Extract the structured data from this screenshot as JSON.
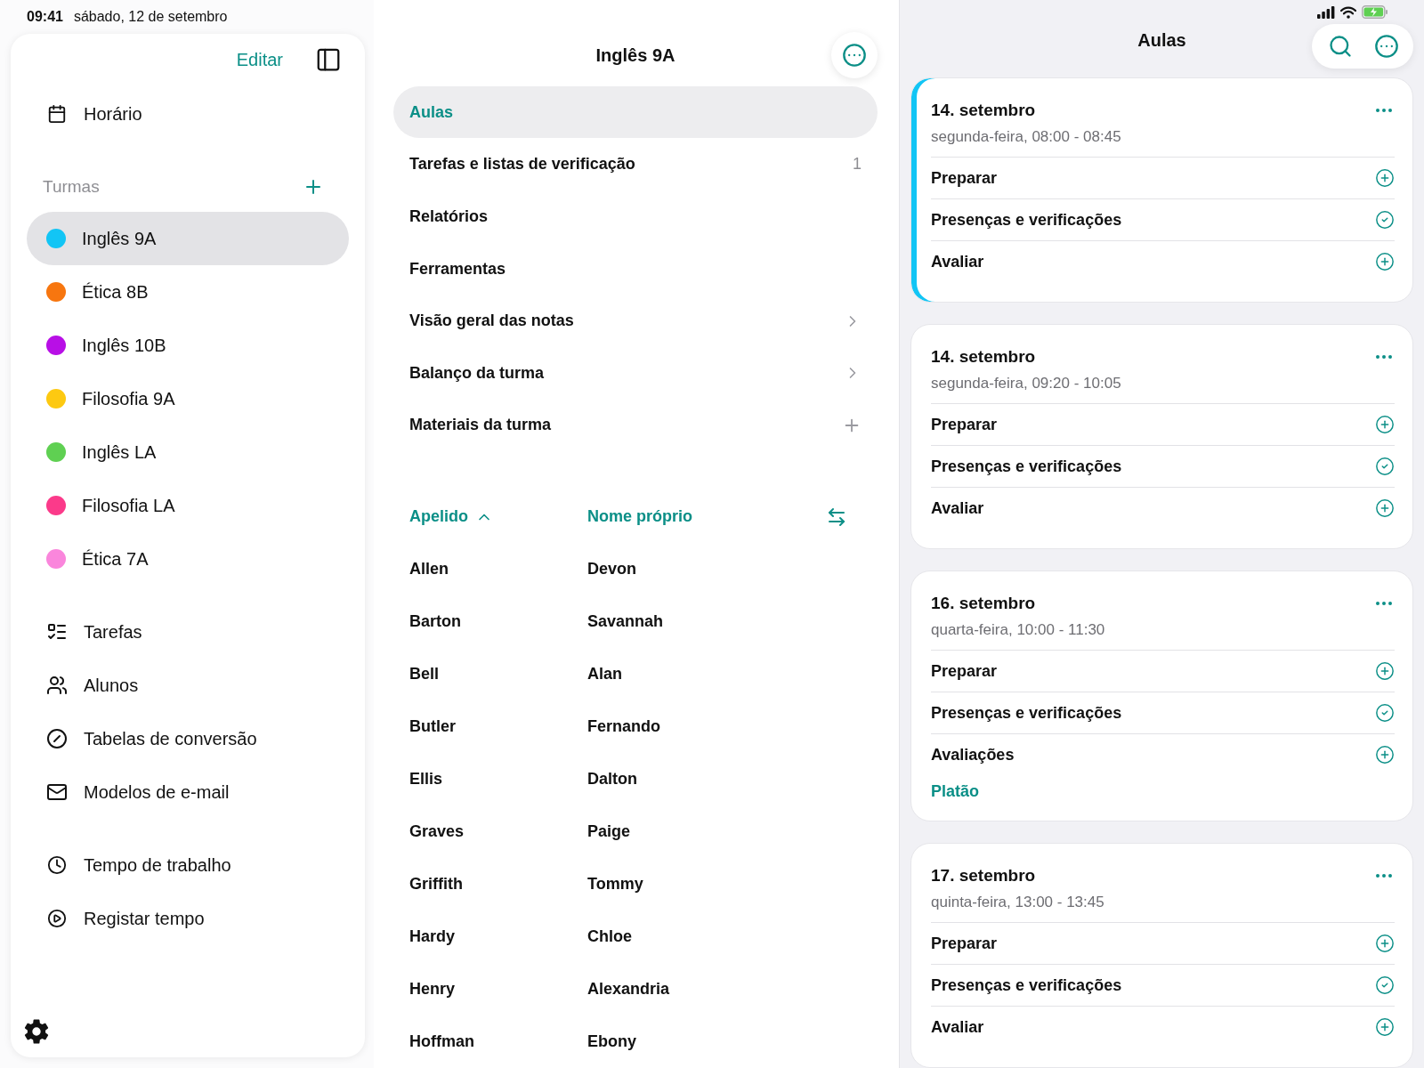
{
  "status_bar": {
    "time": "09:41",
    "date": "sábado, 12 de setembro"
  },
  "sidebar": {
    "edit_button": "Editar",
    "schedule": {
      "label": "Horário"
    },
    "classes_header": "Turmas",
    "classes": [
      {
        "label": "Inglês 9A",
        "color": "#12c5f5",
        "selected": true
      },
      {
        "label": "Ética 8B",
        "color": "#f7760f",
        "selected": false
      },
      {
        "label": "Inglês 10B",
        "color": "#b80fe6",
        "selected": false
      },
      {
        "label": "Filosofia 9A",
        "color": "#fdc911",
        "selected": false
      },
      {
        "label": "Inglês LA",
        "color": "#5fd052",
        "selected": false
      },
      {
        "label": "Filosofia LA",
        "color": "#fb3a8a",
        "selected": false
      },
      {
        "label": "Ética 7A",
        "color": "#fa86dc",
        "selected": false
      }
    ],
    "tools": [
      {
        "label": "Tarefas",
        "kind": "tasks"
      },
      {
        "label": "Alunos",
        "kind": "students"
      },
      {
        "label": "Tabelas de conversão",
        "kind": "conversion"
      },
      {
        "label": "Modelos de e-mail",
        "kind": "email"
      }
    ],
    "time_items": [
      {
        "label": "Tempo de trabalho",
        "kind": "clock"
      },
      {
        "label": "Registar tempo",
        "kind": "record"
      }
    ]
  },
  "class_view": {
    "title": "Inglês 9A",
    "menu": [
      {
        "label": "Aulas",
        "selected": true,
        "kind": "plain"
      },
      {
        "label": "Tarefas e listas de verificação",
        "selected": false,
        "kind": "count",
        "count": "1"
      },
      {
        "label": "Relatórios",
        "selected": false,
        "kind": "plain"
      },
      {
        "label": "Ferramentas",
        "selected": false,
        "kind": "plain"
      },
      {
        "label": "Visão geral das notas",
        "selected": false,
        "kind": "chevron"
      },
      {
        "label": "Balanço da turma",
        "selected": false,
        "kind": "chevron"
      },
      {
        "label": "Materiais da turma",
        "selected": false,
        "kind": "add"
      }
    ],
    "sort_columns": [
      {
        "label": "Apelido",
        "sorted": true
      },
      {
        "label": "Nome próprio",
        "sorted": false
      }
    ],
    "students": [
      {
        "last_name": "Allen",
        "first_name": "Devon"
      },
      {
        "last_name": "Barton",
        "first_name": "Savannah"
      },
      {
        "last_name": "Bell",
        "first_name": "Alan"
      },
      {
        "last_name": "Butler",
        "first_name": "Fernando"
      },
      {
        "last_name": "Ellis",
        "first_name": "Dalton"
      },
      {
        "last_name": "Graves",
        "first_name": "Paige"
      },
      {
        "last_name": "Griffith",
        "first_name": "Tommy"
      },
      {
        "last_name": "Hardy",
        "first_name": "Chloe"
      },
      {
        "last_name": "Henry",
        "first_name": "Alexandria"
      },
      {
        "last_name": "Hoffman",
        "first_name": "Ebony"
      }
    ]
  },
  "lessons_panel": {
    "title": "Aulas",
    "lessons": [
      {
        "date": "14. setembro",
        "time": "segunda-feira, 08:00 - 08:45",
        "selected": true,
        "rows": [
          {
            "label": "Preparar",
            "kind": "add"
          },
          {
            "label": "Presenças e verificações",
            "kind": "done"
          },
          {
            "label": "Avaliar",
            "kind": "add"
          }
        ]
      },
      {
        "date": "14. setembro",
        "time": "segunda-feira, 09:20 - 10:05",
        "selected": false,
        "rows": [
          {
            "label": "Preparar",
            "kind": "add"
          },
          {
            "label": "Presenças e verificações",
            "kind": "done"
          },
          {
            "label": "Avaliar",
            "kind": "add"
          }
        ]
      },
      {
        "date": "16. setembro",
        "time": "quarta-feira, 10:00 - 11:30",
        "selected": false,
        "rows": [
          {
            "label": "Preparar",
            "kind": "add"
          },
          {
            "label": "Presenças e verificações",
            "kind": "done"
          },
          {
            "label": "Avaliações",
            "kind": "add"
          }
        ],
        "tags": [
          "Platão"
        ]
      },
      {
        "date": "17. setembro",
        "time": "quinta-feira, 13:00 - 13:45",
        "selected": false,
        "rows": [
          {
            "label": "Preparar",
            "kind": "add"
          },
          {
            "label": "Presenças e verificações",
            "kind": "done"
          },
          {
            "label": "Avaliar",
            "kind": "add"
          }
        ]
      }
    ]
  }
}
